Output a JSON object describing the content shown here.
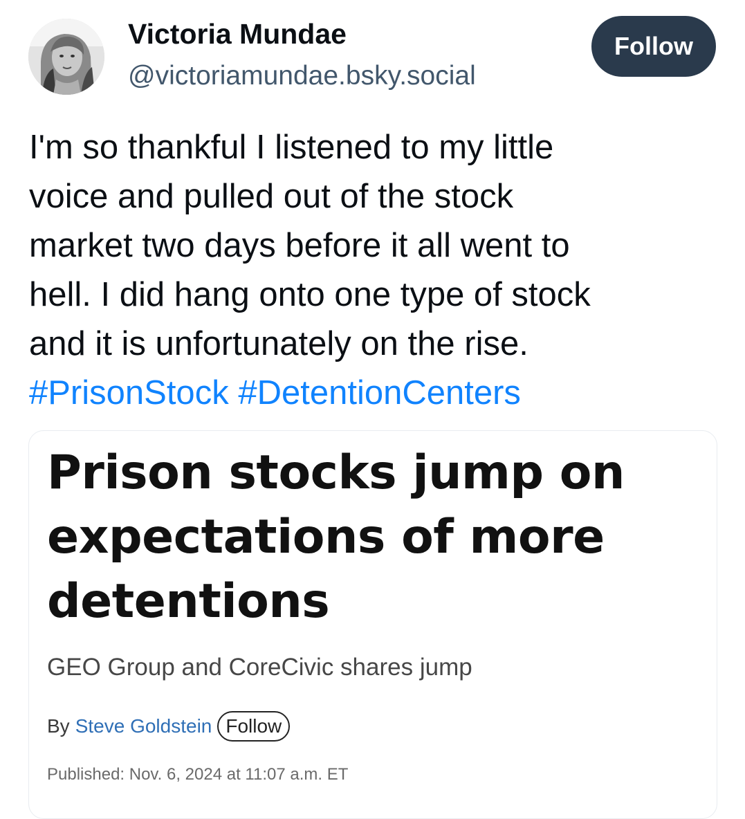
{
  "post": {
    "author": {
      "display_name": "Victoria Mundae",
      "handle": "@victoriamundae.bsky.social",
      "avatar_icon": "profile-photo"
    },
    "follow_label": "Follow",
    "text_lines": [
      "I'm so thankful I listened to my little",
      "voice and pulled out of the stock",
      "market two days before it all went to",
      "hell. I did hang onto one type of stock",
      "and it is unfortunately on the rise."
    ],
    "hashtags": [
      "#PrisonStock",
      "#DetentionCenters"
    ],
    "hashtag_color": "#1083fe"
  },
  "embed": {
    "title_lines": [
      "Prison stocks jump on",
      "expectations of more",
      "detentions"
    ],
    "subtitle": "GEO Group and CoreCivic shares jump",
    "byline_prefix": "By",
    "author": "Steve Goldstein",
    "author_follow_label": "Follow",
    "published": "Published: Nov. 6, 2024 at 11:07 a.m. ET"
  },
  "colors": {
    "follow_button_bg": "#2a3a4c",
    "handle": "#42576c",
    "author_link": "#2f6fb6"
  }
}
